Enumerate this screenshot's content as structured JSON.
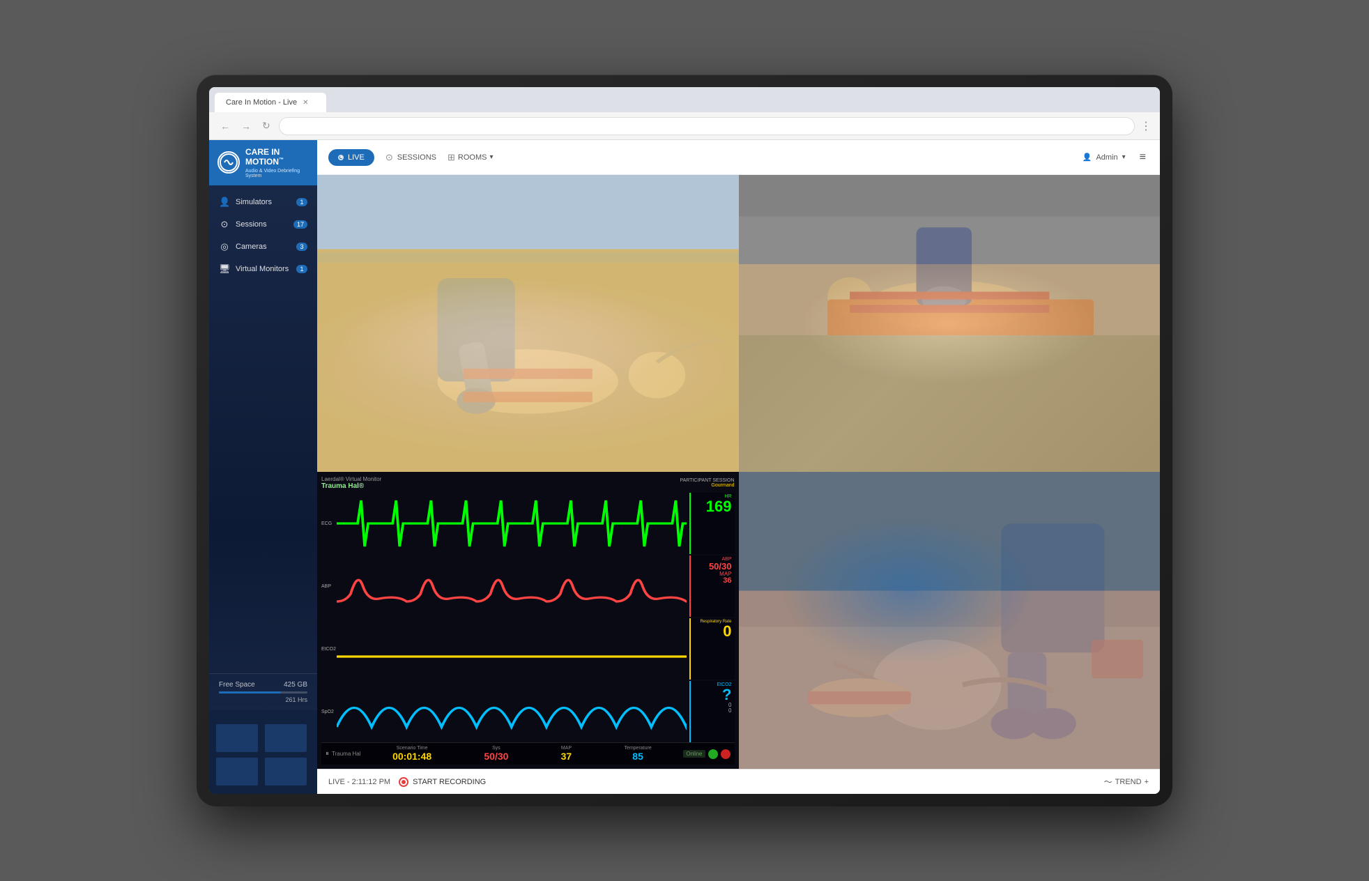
{
  "browser": {
    "tab_title": "Care In Motion - Live",
    "address": ""
  },
  "app": {
    "title": "CARE IN MOTION",
    "subtitle": "Audio & Video Debriefing System",
    "trademark": "™"
  },
  "nav": {
    "live_label": "LIVE",
    "sessions_label": "SESSIONS",
    "rooms_label": "ROOMS",
    "admin_label": "Admin",
    "hamburger": "≡"
  },
  "sidebar": {
    "items": [
      {
        "id": "simulators",
        "label": "Simulators",
        "icon": "👤",
        "badge": "1"
      },
      {
        "id": "sessions",
        "label": "Sessions",
        "icon": "⊙",
        "badge": "17"
      },
      {
        "id": "cameras",
        "label": "Cameras",
        "icon": "◎",
        "badge": "3"
      },
      {
        "id": "virtual-monitors",
        "label": "Virtual Monitors",
        "icon": "🖥",
        "badge": "1"
      }
    ],
    "storage": {
      "label": "Free Space",
      "value": "425 GB",
      "hours": "261 Hrs",
      "fill_percent": 70
    }
  },
  "patient_monitor": {
    "window_title": "Laerdal® Virtual Monitor",
    "patient_name": "Trauma Hal®",
    "session_label": "PARTICIPANT SESSION",
    "session_name": "Gourmand",
    "tracks": [
      {
        "id": "ecg",
        "label": "ECG",
        "color": "#00ff00"
      },
      {
        "id": "abp",
        "label": "ABP",
        "color": "#ff4444"
      },
      {
        "id": "etco2",
        "label": "EtCO2",
        "color": "#ffd700"
      },
      {
        "id": "spo2",
        "label": "SpO2",
        "color": "#00bfff"
      }
    ],
    "vitals": {
      "heart_rate": {
        "label": "Heart Rate",
        "value": "169",
        "color": "#00ff00"
      },
      "abp_sys": {
        "label": "ABP",
        "value": "50/30",
        "color": "#ff4444"
      },
      "map": {
        "label": "MAP",
        "value": "36",
        "color": "#ff4444"
      },
      "respiratory": {
        "label": "Respiratory Rate",
        "value": "0",
        "color": "#ffd700"
      },
      "etco2": {
        "label": "EtCO2",
        "value": "?",
        "color": "#00bfff"
      }
    },
    "bottom_stats": [
      {
        "label": "Scenario Time",
        "value": "00:01:48",
        "color": "#ffd700"
      },
      {
        "label": "Sys",
        "value": "50/30",
        "color": "#ff4444"
      },
      {
        "label": "MAP",
        "sublabel": "36",
        "value": "37",
        "color": "#ffd700"
      },
      {
        "label": "Temperature",
        "value": "85",
        "color": "#00bfff"
      }
    ]
  },
  "status_bar": {
    "live_time": "LIVE - 2:11:12 PM",
    "record_label": "START RECORDING",
    "trend_label": "TREND"
  }
}
